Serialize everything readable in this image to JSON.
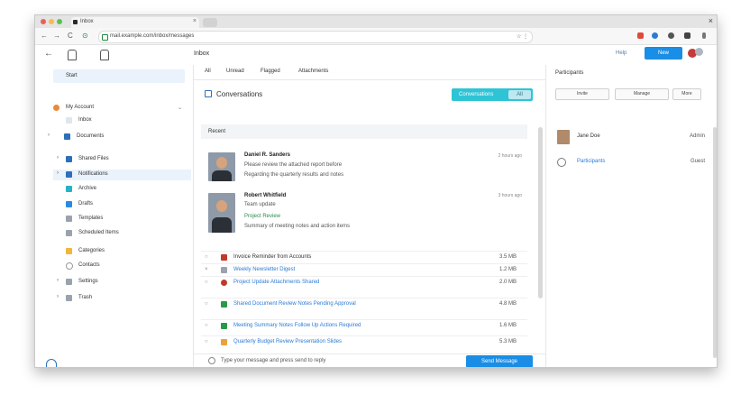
{
  "browser": {
    "tab_title": "Inbox",
    "tab_close": "×",
    "window_close": "×",
    "url": "mail.example.com/inbox/messages",
    "nav_back": "←",
    "nav_forward": "→",
    "nav_reload": "C",
    "omni_icons": "☆ ⋮"
  },
  "header": {
    "back": "←",
    "title": "Inbox",
    "help_link": "Help",
    "primary_button": "New"
  },
  "sidebar": {
    "top_item": "Start",
    "account": "My Account",
    "items": [
      {
        "label": "Inbox"
      },
      {
        "label": "Documents"
      },
      {
        "label": "Shared Files"
      },
      {
        "label": "Notifications"
      },
      {
        "label": "Archive"
      },
      {
        "label": "Drafts"
      },
      {
        "label": "Templates"
      },
      {
        "label": "Scheduled Items"
      },
      {
        "label": "Categories"
      },
      {
        "label": "Contacts"
      },
      {
        "label": "Settings"
      },
      {
        "label": "Trash"
      }
    ],
    "bottom_label": "Help"
  },
  "main": {
    "tabs": [
      "All",
      "Unread",
      "Flagged",
      "Attachments"
    ],
    "title": "Conversations",
    "seg_active": "Conversations",
    "seg_other": "All",
    "section": "Recent",
    "messages": [
      {
        "name": "Daniel R. Sanders",
        "line1": "Please review the attached report before",
        "line2": "Regarding the quarterly results and notes",
        "ago": "2 hours ago"
      },
      {
        "name": "Robert Whitfield",
        "line1": "Team update",
        "line2": "Project Review",
        "line3": "Summary of meeting notes and action items",
        "ago": "3 hours ago"
      }
    ],
    "rows": [
      {
        "text": "Invoice Reminder from Accounts",
        "value": "3.5 MB"
      },
      {
        "text": "Weekly Newsletter Digest",
        "value": "1.2 MB"
      },
      {
        "text": "Project Update Attachments Shared",
        "value": "2.0 MB"
      },
      {
        "text": "Shared Document Review Notes Pending Approval",
        "value": "4.8 MB"
      },
      {
        "text": "Meeting Summary Notes Follow Up Actions Required",
        "value": "1.6 MB"
      },
      {
        "text": "Quarterly Budget Review Presentation Slides",
        "value": "5.3 MB"
      }
    ],
    "compose_text": "Type your message and press send to reply",
    "send_button": "Send Message"
  },
  "right": {
    "title": "Participants",
    "btn1": "Invite",
    "btn2": "Manage",
    "btn3": "More",
    "people": [
      {
        "name": "Jane Doe",
        "value": "Admin"
      },
      {
        "name": "Participants",
        "value": "Guest"
      }
    ]
  },
  "colors": {
    "accent": "#1a8de6",
    "segment": "#2ec4d6"
  }
}
